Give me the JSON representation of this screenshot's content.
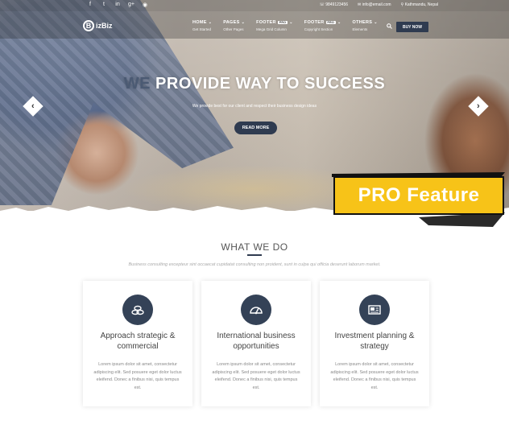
{
  "topbar": {
    "social": [
      "f",
      "t",
      "in",
      "g+",
      "◉"
    ],
    "phone": "☏ 9849123456",
    "email": "✉ info@email.com",
    "location": "⚲ Kathmandu, Nepal"
  },
  "brand": {
    "logo_letter": "B",
    "name": "izBiz"
  },
  "nav": {
    "items": [
      {
        "label": "HOME",
        "sub": "Get Started",
        "pro": ""
      },
      {
        "label": "PAGES",
        "sub": "Other Pages",
        "pro": ""
      },
      {
        "label": "FOOTER",
        "sub": "Mega Grid Column",
        "pro": "PRO"
      },
      {
        "label": "FOOTER",
        "sub": "Copyright Section",
        "pro": "PRO"
      },
      {
        "label": "OTHERS",
        "sub": "Elements",
        "pro": ""
      }
    ],
    "buy_label": "BUY NOW"
  },
  "hero": {
    "heading_we": "WE",
    "heading_rest": " PROVIDE WAY TO SUCCESS",
    "tagline": "We provide best for our client and respect their business design ideas",
    "cta": "READ MORE",
    "prev": "‹",
    "next": "›"
  },
  "badge": {
    "text": "PRO Feature"
  },
  "whatwedo": {
    "title": "WHAT WE DO",
    "subtitle": "Business consulting excepteur sint occaecat cupidatat consulting non proident, sunt in culpa qui officia deserunt laborum market."
  },
  "cards": [
    {
      "icon": "coins-icon",
      "title": "Approach strategic & commercial",
      "text": "Lorem ipsum dolor sit amet, consectetur adipiscing elit. Sed posuere eget dolor luctus eleifend. Donec a finibus nisi, quis tempus est."
    },
    {
      "icon": "speedometer-icon",
      "title": "International business opportunities",
      "text": "Lorem ipsum dolor sit amet, consectetur adipiscing elit. Sed posuere eget dolor luctus eleifend. Donec a finibus nisi, quis tempus est."
    },
    {
      "icon": "newspaper-icon",
      "title": "Investment planning & strategy",
      "text": "Lorem ipsum dolor sit amet, consectetur adipiscing elit. Sed posuere eget dolor luctus eleifend. Donec a finibus nisi, quis tempus est."
    }
  ],
  "colors": {
    "accent": "#2f3b50",
    "badge": "#f7c318"
  }
}
